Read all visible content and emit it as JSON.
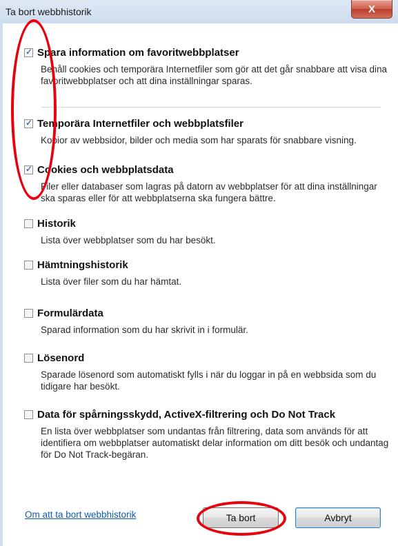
{
  "window": {
    "title": "Ta bort webbhistorik",
    "close_glyph": "X"
  },
  "items": [
    {
      "label": "Spara information om favoritwebbplatser",
      "checked": true,
      "description": "Behåll cookies och temporära Internetfiler som gör att det går snabbare att visa dina favoritwebbplatser och att dina inställningar sparas."
    },
    {
      "label": "Temporära Internetfiler och webbplatsfiler",
      "checked": true,
      "description": "Kopior av webbsidor, bilder och media som har sparats för snabbare visning."
    },
    {
      "label": "Cookies och webbplatsdata",
      "checked": true,
      "description": "Filer eller databaser som lagras på datorn av webbplatser för att dina inställningar ska sparas eller för att webbplatserna ska fungera bättre."
    },
    {
      "label": "Historik",
      "checked": false,
      "description": "Lista över webbplatser som du har besökt."
    },
    {
      "label": "Hämtningshistorik",
      "checked": false,
      "description": "Lista över filer som du har hämtat."
    },
    {
      "label": "Formulärdata",
      "checked": false,
      "description": "Sparad information som du har skrivit in i formulär."
    },
    {
      "label": "Lösenord",
      "checked": false,
      "description": "Sparade lösenord som automatiskt fylls i när du loggar in på en webbsida som du tidigare har besökt."
    },
    {
      "label": "Data för spårningsskydd, ActiveX-filtrering och Do Not Track",
      "checked": false,
      "description": "En lista över webbplatser som undantas från filtrering, data som används för att identifiera om webbplatser automatiskt delar information om ditt besök och undantag för Do Not Track-begäran."
    }
  ],
  "footer": {
    "link": "Om att ta bort webbhistorik",
    "delete_button": "Ta bort",
    "cancel_button": "Avbryt"
  },
  "annotation_color": "#e8000e"
}
